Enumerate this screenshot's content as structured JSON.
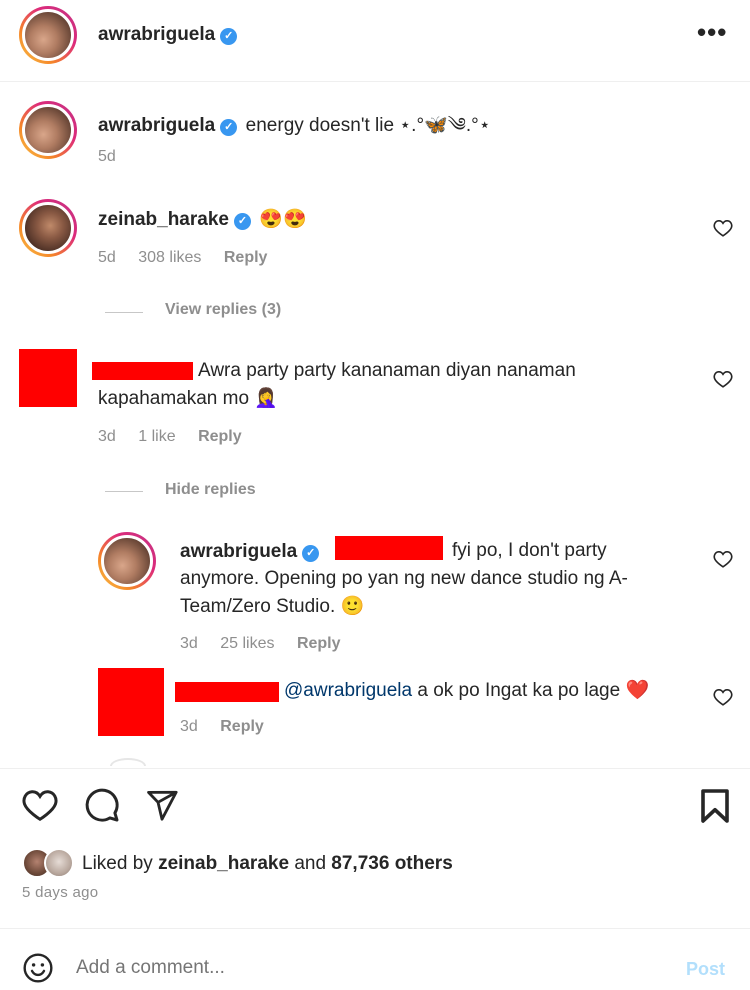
{
  "header": {
    "username": "awrabriguela",
    "more_icon": "more-horizontal-icon"
  },
  "caption": {
    "username": "awrabriguela",
    "text": "energy doesn't lie ⋆.°🦋༄.°⋆",
    "time": "5d"
  },
  "comments": [
    {
      "username": "zeinab_harake",
      "text": "😍😍",
      "time": "5d",
      "likes": "308 likes",
      "reply": "Reply"
    },
    {
      "username_redacted": true,
      "text_line1": "Awra party party kananaman diyan nanaman",
      "text_line2": "kapahamakan mo 🤦‍♀️",
      "time": "3d",
      "likes": "1 like",
      "reply": "Reply"
    }
  ],
  "view_replies": "View replies (3)",
  "hide_replies": "Hide replies",
  "replies": [
    {
      "username": "awrabriguela",
      "text_line1": "fyi po, I don't party",
      "text_line2": "anymore. Opening po yan ng new dance studio ng A-",
      "text_line3": "Team/Zero Studio. 🙂",
      "time": "3d",
      "likes": "25 likes",
      "reply": "Reply"
    },
    {
      "mention": "@awrabriguela",
      "text": "a ok po Ingat ka po lage ❤️",
      "time": "3d",
      "reply": "Reply"
    }
  ],
  "actions": {
    "like_icon": "heart-icon",
    "comment_icon": "comment-icon",
    "share_icon": "send-icon",
    "save_icon": "bookmark-icon"
  },
  "likes": {
    "prefix": "Liked by",
    "user": "zeinab_harake",
    "and": "and",
    "count": "87,736 others"
  },
  "post_time": "5 days ago",
  "add_comment": {
    "placeholder": "Add a comment...",
    "post_label": "Post",
    "emoji_icon": "smiley-icon"
  },
  "colors": {
    "verified": "#3897f0",
    "redaction": "#ff0000",
    "mention": "#00376b"
  }
}
